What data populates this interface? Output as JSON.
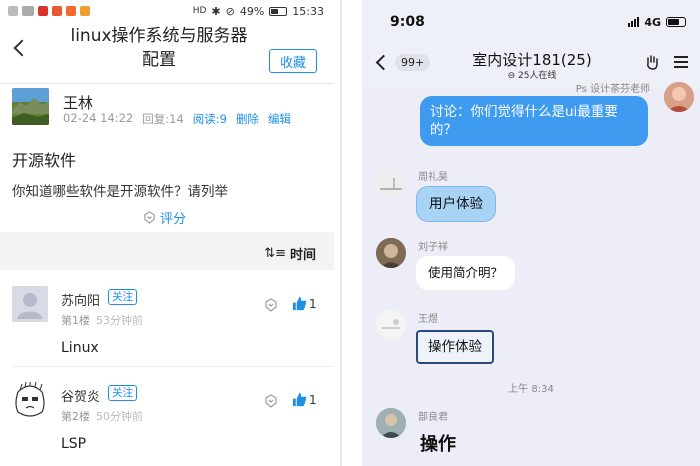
{
  "left": {
    "status": {
      "battery": "49%",
      "time": "15:33"
    },
    "header": {
      "title": "linux操作系统与服务器配置",
      "favorite": "收藏"
    },
    "post": {
      "author": "王林",
      "date": "02-24 14:22",
      "replies": "回复:14",
      "reads": "阅读:9",
      "delete": "删除",
      "edit": "编辑",
      "title": "开源软件",
      "body": "你知道哪些软件是开源软件？请列举",
      "rate": "评分"
    },
    "sort": {
      "label": "时间"
    },
    "replies": [
      {
        "name": "苏向阳",
        "follow": "关注",
        "floor": "第1楼",
        "time": "53分钟前",
        "text": "Linux",
        "likes": "1"
      },
      {
        "name": "谷贺炎",
        "follow": "关注",
        "floor": "第2楼",
        "time": "50分钟前",
        "text": "LSP",
        "likes": "1"
      }
    ]
  },
  "right": {
    "status": {
      "time": "9:08",
      "network": "4G"
    },
    "header": {
      "back_badge": "99+",
      "title": "室内设计181(25)",
      "online": "25人在线"
    },
    "messages": [
      {
        "sender": "Ps 设计茶芬老师",
        "text": "讨论：你们觉得什么是ui最重要的？",
        "self": true
      },
      {
        "sender": "周礼昊",
        "text": "用户体验"
      },
      {
        "sender": "刘子祥",
        "text": "使用简介明？"
      },
      {
        "sender": "王煜",
        "text": "操作体验"
      },
      {
        "sender": "部良君",
        "text": "操作"
      }
    ],
    "time_separator": "上午 8:34",
    "colors": {
      "self_bubble": "#3e9bf0",
      "sticker_bubble": "#a9d3f5"
    }
  }
}
